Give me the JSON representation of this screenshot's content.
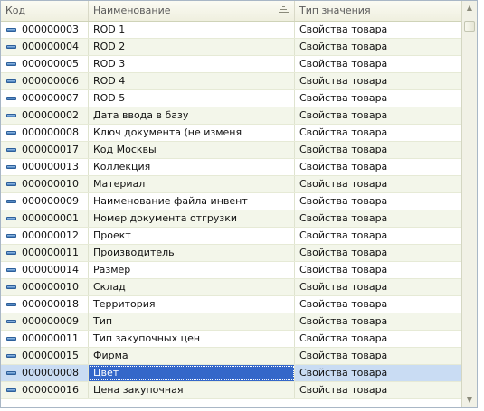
{
  "table": {
    "columns": {
      "code": "Код",
      "name": "Наименование",
      "value_type": "Тип значения"
    },
    "sorted_column": "name",
    "rows": [
      {
        "code": "000000003",
        "name": "ROD 1",
        "value_type": "Свойства товара"
      },
      {
        "code": "000000004",
        "name": "ROD 2",
        "value_type": "Свойства товара"
      },
      {
        "code": "000000005",
        "name": "ROD 3",
        "value_type": "Свойства товара"
      },
      {
        "code": "000000006",
        "name": "ROD 4",
        "value_type": "Свойства товара"
      },
      {
        "code": "000000007",
        "name": "ROD 5",
        "value_type": "Свойства товара"
      },
      {
        "code": "000000002",
        "name": "Дата ввода в базу",
        "value_type": "Свойства товара"
      },
      {
        "code": "000000008",
        "name": "Ключ документа (не изменя",
        "value_type": "Свойства товара"
      },
      {
        "code": "000000017",
        "name": "Код Москвы",
        "value_type": "Свойства товара"
      },
      {
        "code": "000000013",
        "name": "Коллекция",
        "value_type": "Свойства товара"
      },
      {
        "code": "000000010",
        "name": "Материал",
        "value_type": "Свойства товара"
      },
      {
        "code": "000000009",
        "name": "Наименование файла инвент",
        "value_type": "Свойства товара"
      },
      {
        "code": "000000001",
        "name": "Номер документа отгрузки",
        "value_type": "Свойства товара"
      },
      {
        "code": "000000012",
        "name": "Проект",
        "value_type": "Свойства товара"
      },
      {
        "code": "000000011",
        "name": "Производитель",
        "value_type": "Свойства товара"
      },
      {
        "code": "000000014",
        "name": "Размер",
        "value_type": "Свойства товара"
      },
      {
        "code": "000000010",
        "name": "Склад",
        "value_type": "Свойства товара"
      },
      {
        "code": "000000018",
        "name": "Территория",
        "value_type": "Свойства товара"
      },
      {
        "code": "000000009",
        "name": "Тип",
        "value_type": "Свойства товара"
      },
      {
        "code": "000000011",
        "name": "Тип закупочных цен",
        "value_type": "Свойства товара"
      },
      {
        "code": "000000015",
        "name": "Фирма",
        "value_type": "Свойства товара"
      },
      {
        "code": "000000008",
        "name": "Цвет",
        "value_type": "Свойства товара",
        "selected": true
      },
      {
        "code": "000000016",
        "name": "Цена закупочная",
        "value_type": "Свойства товара"
      }
    ]
  },
  "icons": {
    "row_icon": "property-item-icon",
    "sort_icon": "sort-order-icon",
    "scroll_up": "scroll-up-arrow-icon",
    "scroll_down": "scroll-down-arrow-icon"
  },
  "colors": {
    "selection": "#3467c9",
    "selected_row": "#c9dcf3",
    "alt_row": "#f3f6ea",
    "header": "#efefdf"
  }
}
